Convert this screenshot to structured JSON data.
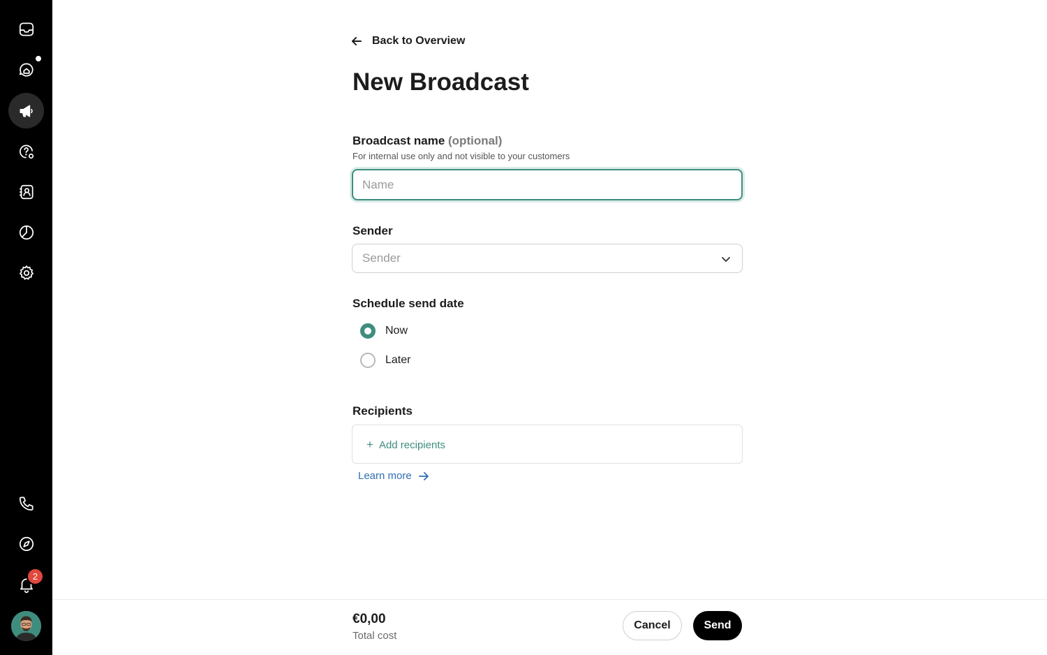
{
  "sidebar": {
    "items": [
      {
        "icon": "inbox-icon"
      },
      {
        "icon": "chat-icon",
        "has_dot": true
      },
      {
        "icon": "megaphone-icon",
        "active": true
      },
      {
        "icon": "help-settings-icon"
      },
      {
        "icon": "contacts-icon"
      },
      {
        "icon": "reports-icon"
      },
      {
        "icon": "gear-icon"
      },
      {
        "icon": "phone-icon"
      },
      {
        "icon": "compass-icon"
      },
      {
        "icon": "bell-icon"
      }
    ],
    "notification_count": "2"
  },
  "header": {
    "back_label": "Back to Overview",
    "title": "New Broadcast"
  },
  "form": {
    "name_label": "Broadcast name",
    "name_optional": "(optional)",
    "name_hint": "For internal use only and not visible to your customers",
    "name_placeholder": "Name",
    "name_value": "",
    "sender_label": "Sender",
    "sender_placeholder": "Sender",
    "schedule_label": "Schedule send date",
    "schedule_options": [
      {
        "label": "Now",
        "selected": true
      },
      {
        "label": "Later",
        "selected": false
      }
    ],
    "recipients_label": "Recipients",
    "add_recipients_label": "Add recipients",
    "learn_more_label": "Learn more"
  },
  "footer": {
    "total_cost": "€0,00",
    "total_cost_label": "Total cost",
    "cancel_label": "Cancel",
    "send_label": "Send"
  },
  "colors": {
    "accent": "#3f8d7f",
    "link": "#2f6fb3",
    "sidebar_bg": "#000000",
    "badge": "#e0473d"
  }
}
